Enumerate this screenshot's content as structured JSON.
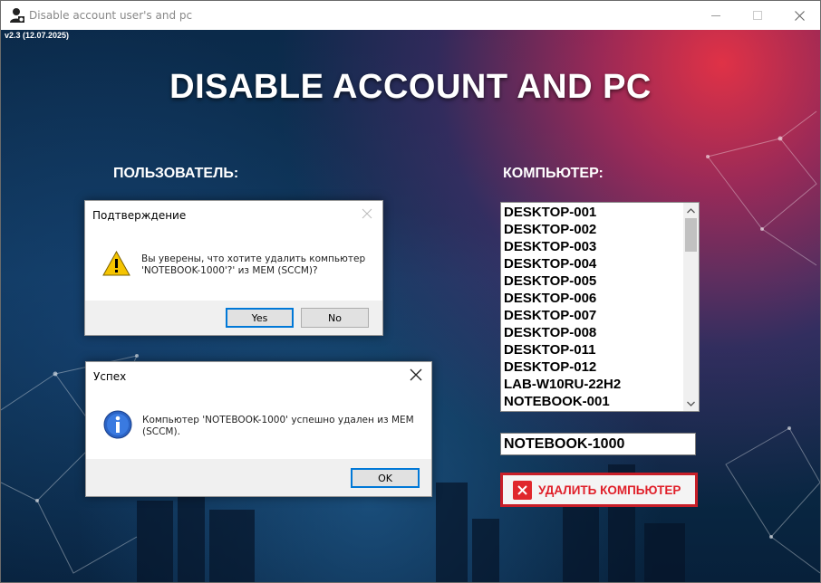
{
  "window": {
    "title": "Disable account user's and pc",
    "version": "v2.3 (12.07.2025)"
  },
  "main": {
    "heading": "DISABLE ACCOUNT AND PC",
    "user_label": "ПОЛЬЗОВАТЕЛЬ:",
    "computer_label": "КОМПЬЮТЕР:",
    "computers": [
      "DESKTOP-001",
      "DESKTOP-002",
      "DESKTOP-003",
      "DESKTOP-004",
      "DESKTOP-005",
      "DESKTOP-006",
      "DESKTOP-007",
      "DESKTOP-008",
      "DESKTOP-011",
      "DESKTOP-012",
      "LAB-W10RU-22H2",
      "NOTEBOOK-001"
    ],
    "computer_input_value": "NOTEBOOK-1000",
    "delete_button_label": "УДАЛИТЬ КОМПЬЮТЕР"
  },
  "confirm_dialog": {
    "title": "Подтверждение",
    "message_line1": "Вы уверены, что хотите удалить компьютер",
    "message_line2": "'NOTEBOOK-1000'?' из MEM (SCCM)?",
    "yes_label": "Yes",
    "no_label": "No",
    "icon": "warning-icon"
  },
  "success_dialog": {
    "title": "Успех",
    "message_line1": "Компьютер 'NOTEBOOK-1000' успешно удален из MEM",
    "message_line2": "(SCCM).",
    "ok_label": "OK",
    "icon": "info-icon"
  },
  "colors": {
    "accent_red": "#e0202a",
    "background_blue": "#0e3558",
    "focus_blue": "#0078d7"
  }
}
